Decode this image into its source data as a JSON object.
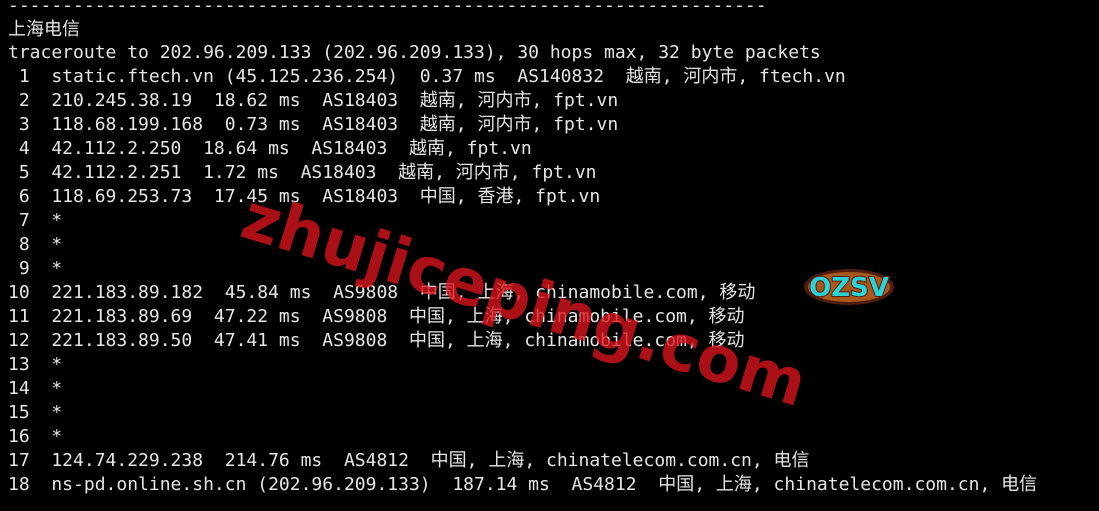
{
  "terminal": {
    "separator": "----------------------------------------------------------------------",
    "heading": "上海电信",
    "command": "traceroute to 202.96.209.133 (202.96.209.133), 30 hops max, 32 byte packets",
    "hops": [
      " 1  static.ftech.vn (45.125.236.254)  0.37 ms  AS140832  越南, 河内市, ftech.vn",
      " 2  210.245.38.19  18.62 ms  AS18403  越南, 河内市, fpt.vn",
      " 3  118.68.199.168  0.73 ms  AS18403  越南, 河内市, fpt.vn",
      " 4  42.112.2.250  18.64 ms  AS18403  越南, fpt.vn",
      " 5  42.112.2.251  1.72 ms  AS18403  越南, 河内市, fpt.vn",
      " 6  118.69.253.73  17.45 ms  AS18403  中国, 香港, fpt.vn",
      " 7  *",
      " 8  *",
      " 9  *",
      "10  221.183.89.182  45.84 ms  AS9808  中国, 上海, chinamobile.com, 移动",
      "11  221.183.89.69  47.22 ms  AS9808  中国, 上海, chinamobile.com, 移动",
      "12  221.183.89.50  47.41 ms  AS9808  中国, 上海, chinamobile.com, 移动",
      "13  *",
      "14  *",
      "15  *",
      "16  *",
      "17  124.74.229.238  214.76 ms  AS4812  中国, 上海, chinatelecom.com.cn, 电信",
      "18  ns-pd.online.sh.cn (202.96.209.133)  187.14 ms  AS4812  中国, 上海, chinatelecom.com.cn, 电信"
    ]
  },
  "watermark": {
    "text": "zhujiceping.com",
    "color": "#dc141e"
  },
  "logo": {
    "text": "OZSV",
    "colors": {
      "fill": "#2ad3d6",
      "outline": "#5a1f12",
      "accent": "#f08a24"
    }
  },
  "colors": {
    "background": "#000000",
    "text": "#e6e6e6"
  }
}
